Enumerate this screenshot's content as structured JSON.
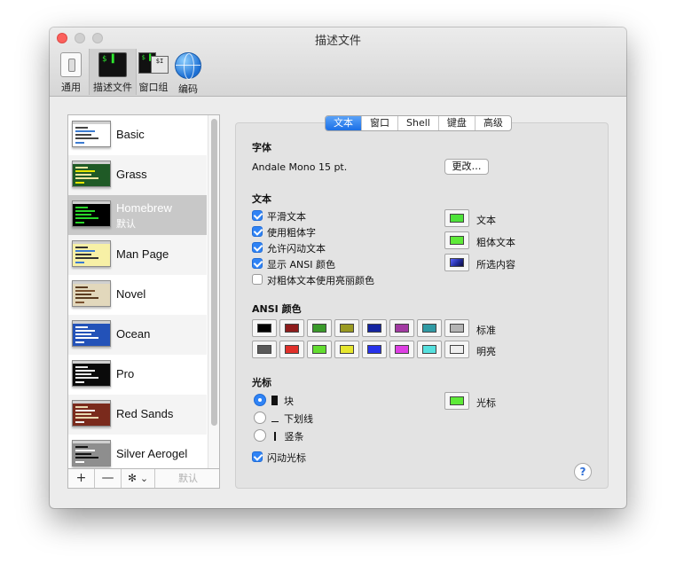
{
  "window": {
    "title": "描述文件"
  },
  "toolbar": {
    "items": [
      {
        "label": "通用",
        "icon": "toggle-switch-icon"
      },
      {
        "label": "描述文件",
        "icon": "terminal-profile-icon",
        "selected": true
      },
      {
        "label": "窗口组",
        "icon": "window-group-icon"
      },
      {
        "label": "编码",
        "icon": "globe-icon"
      }
    ],
    "term_glyph": "$ ▌",
    "group_glyph_1": "$ ▌",
    "group_glyph_2": "$I"
  },
  "profiles": {
    "items": [
      {
        "name": "Basic",
        "bg": "#ffffff",
        "fg": "#444444",
        "accent": "#3b7bd1"
      },
      {
        "name": "Grass",
        "bg": "#1f5a26",
        "fg": "#f2e6a0",
        "accent": "#e6e600"
      },
      {
        "name": "Homebrew",
        "bg": "#000000",
        "fg": "#29d629",
        "accent": "#29d629",
        "selected": true,
        "default_label": "默认"
      },
      {
        "name": "Man Page",
        "bg": "#f7f0a6",
        "fg": "#333333",
        "accent": "#3b7bd1"
      },
      {
        "name": "Novel",
        "bg": "#e2d8bc",
        "fg": "#5a3c20",
        "accent": "#7a5230"
      },
      {
        "name": "Ocean",
        "bg": "#2352b8",
        "fg": "#ffffff",
        "accent": "#ffffff"
      },
      {
        "name": "Pro",
        "bg": "#0a0a0a",
        "fg": "#e8e8e8",
        "accent": "#ffffff"
      },
      {
        "name": "Red Sands",
        "bg": "#7a2a1c",
        "fg": "#e8d8b0",
        "accent": "#f0f0f0"
      },
      {
        "name": "Silver Aerogel",
        "bg": "#8e8e8e",
        "fg": "#111111",
        "accent": "#ffffff"
      }
    ],
    "toolbar": {
      "add": "+",
      "remove": "—",
      "gear": "✻",
      "chevron": "⌄",
      "default_button": "默认"
    }
  },
  "tabs": {
    "items": [
      {
        "label": "文本",
        "active": true
      },
      {
        "label": "窗口"
      },
      {
        "label": "Shell"
      },
      {
        "label": "键盘"
      },
      {
        "label": "高级"
      }
    ]
  },
  "font_section": {
    "title": "字体",
    "font_value": "Andale Mono 15 pt.",
    "change_button": "更改…"
  },
  "text_section": {
    "title": "文本",
    "options": [
      {
        "label": "平滑文本",
        "checked": true
      },
      {
        "label": "使用粗体字",
        "checked": true
      },
      {
        "label": "允许闪动文本",
        "checked": true
      },
      {
        "label": "显示 ANSI 颜色",
        "checked": true
      },
      {
        "label": "对粗体文本使用亮丽颜色",
        "checked": false
      }
    ],
    "colors": [
      {
        "label": "文本",
        "color": "#4ee33a"
      },
      {
        "label": "粗体文本",
        "color": "#5eea38"
      },
      {
        "label": "所选内容",
        "color": "#2530a8"
      }
    ]
  },
  "ansi_section": {
    "title": "ANSI 颜色",
    "normal_label": "标准",
    "bright_label": "明亮",
    "normal": [
      "#000000",
      "#8e1c1c",
      "#3a9a2a",
      "#9a9a22",
      "#1424a0",
      "#a23aa2",
      "#2f9aa4",
      "#b4b4b4"
    ],
    "bright": [
      "#5a5a5a",
      "#e0302a",
      "#63dd30",
      "#e6e62e",
      "#2833ea",
      "#dd3fe3",
      "#55e0de",
      "#eeeeee"
    ]
  },
  "cursor_section": {
    "title": "光标",
    "options": [
      {
        "label": "块",
        "selected": true
      },
      {
        "label": "下划线",
        "selected": false
      },
      {
        "label": "竖条",
        "selected": false
      }
    ],
    "blink_label": "闪动光标",
    "blink_checked": true,
    "color_label": "光标",
    "color": "#5eea38"
  },
  "help_label": "?"
}
